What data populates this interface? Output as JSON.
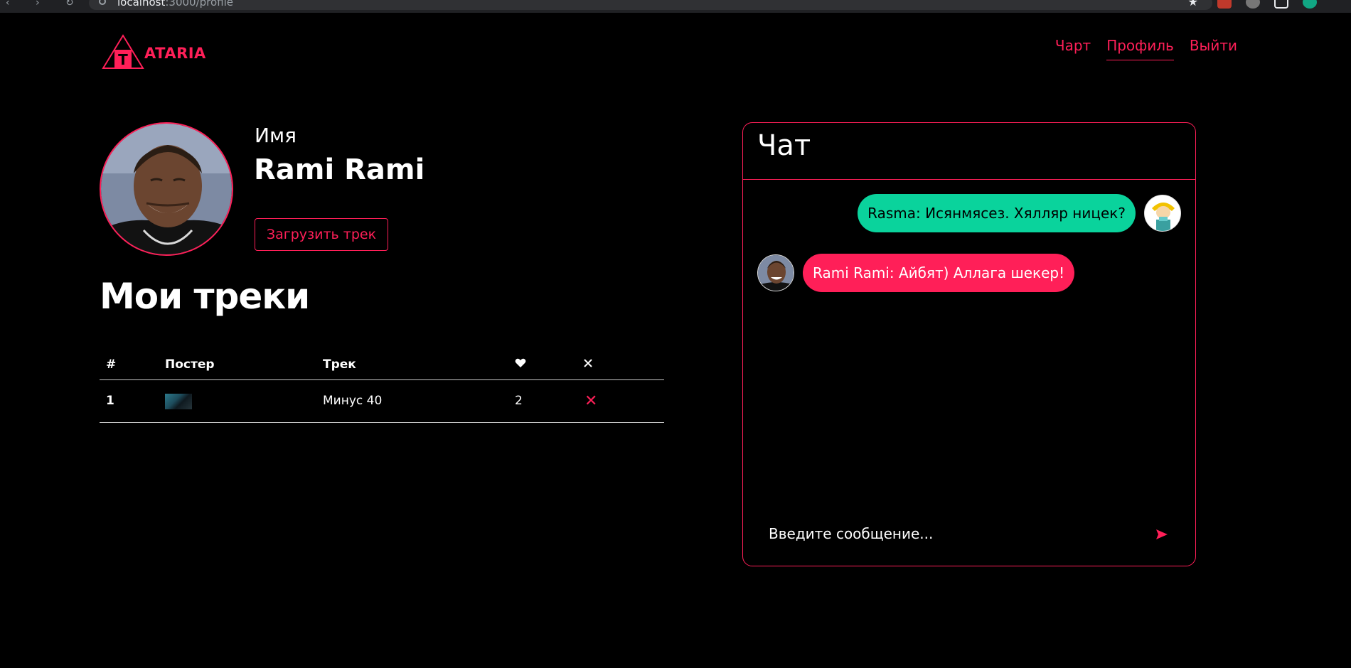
{
  "browser": {
    "url_host": "localhost",
    "url_rest": ":3000/profile"
  },
  "header": {
    "logo_letter": "T",
    "logo_text": "ATARIA",
    "nav": [
      {
        "label": "Чарт",
        "active": false
      },
      {
        "label": "Профиль",
        "active": true
      },
      {
        "label": "Выйти",
        "active": false
      }
    ]
  },
  "profile": {
    "name_label": "Имя",
    "name_value": "Rami Rami",
    "upload_label": "Загрузить трек"
  },
  "tracks": {
    "title": "Мои треки",
    "columns": {
      "number": "#",
      "poster": "Постер",
      "track": "Трек",
      "likes_icon": "heart-icon",
      "delete_icon": "close-icon"
    },
    "rows": [
      {
        "number": "1",
        "track": "Минус 40",
        "likes": "2"
      }
    ]
  },
  "chat": {
    "title": "Чат",
    "messages": [
      {
        "text": "Rasma: Исянмясез. Хялляр ницек?",
        "direction": "incoming",
        "color": "#0ad39c"
      },
      {
        "text": "Rami Rami: Айбят) Аллага шекер!",
        "direction": "outgoing",
        "color": "#ff1f58"
      }
    ],
    "input_placeholder": "Введите сообщение..."
  },
  "colors": {
    "accent": "#ff1f58",
    "incoming_bubble": "#0ad39c",
    "background": "#000000"
  }
}
